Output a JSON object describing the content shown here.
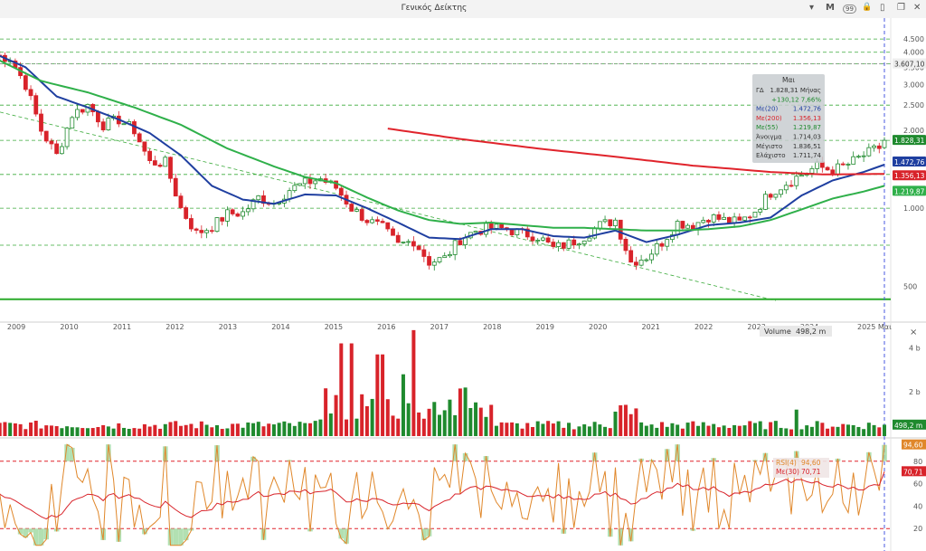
{
  "window": {
    "title": "Γενικός Δείκτης",
    "controls": {
      "dropdown": "▾",
      "period": "M",
      "badge": "99",
      "lock": "🔒",
      "split": "▯",
      "restore": "❐",
      "close": "✕"
    }
  },
  "colors": {
    "up": "#1f8a2e",
    "down": "#d8232a",
    "ma20": "#1f3fa0",
    "ma55": "#2fb04a",
    "ma200": "#e0242c",
    "rsi": "#e0872a",
    "rsiAvg": "#d8232a"
  },
  "chart_data": {
    "type": "candlestick",
    "interval": "monthly",
    "price_axis": {
      "scale": "log",
      "ticks": [
        "4.500",
        "4.000",
        "3.500",
        "3.000",
        "2.500",
        "2.000",
        "1.500",
        "1.000",
        "500"
      ]
    },
    "x_ticks": [
      "2009",
      "2010",
      "2011",
      "2012",
      "2013",
      "2014",
      "2015",
      "2016",
      "2017",
      "2018",
      "2019",
      "2020",
      "2021",
      "2022",
      "2023",
      "2024",
      "2025"
    ],
    "current_period_label": "Μαι",
    "last_label": "2025 Μαι",
    "horizontal_levels": [
      {
        "label": "3.607,10"
      },
      {
        "label": "1.828,31"
      }
    ],
    "infobox": {
      "header": "Μαι",
      "rows": [
        {
          "k": "ΓΔ",
          "v": "1.828,31 Μήνας",
          "color": "#333"
        },
        {
          "k": "",
          "v": "+130,12 7,66%",
          "color": "#1f8a2e"
        },
        {
          "k": "Με(20)",
          "v": "1.472,76",
          "color": "#1f3fa0"
        },
        {
          "k": "Με(200)",
          "v": "1.356,13",
          "color": "#d8232a"
        },
        {
          "k": "Με(55)",
          "v": "1.219,87",
          "color": "#1f8a2e"
        },
        {
          "k": "Άνοιγμα",
          "v": "1.714,03",
          "color": "#333"
        },
        {
          "k": "Μέγιστο",
          "v": "1.836,51",
          "color": "#333"
        },
        {
          "k": "Ελάχιστο",
          "v": "1.711,74",
          "color": "#333"
        }
      ]
    },
    "price_labels": [
      {
        "text": "1.828,31",
        "color": "#1f8a2e",
        "value": 1828.31
      },
      {
        "text": "1.472,76",
        "color": "#1f3fa0",
        "value": 1472.76
      },
      {
        "text": "1.356,13",
        "color": "#d8232a",
        "value": 1356.13
      },
      {
        "text": "1.219,87",
        "color": "#2fb04a",
        "value": 1219.87
      }
    ],
    "price_anchors": [
      [
        0,
        3900
      ],
      [
        3,
        3800
      ],
      [
        6,
        3000
      ],
      [
        9,
        2000
      ],
      [
        12,
        1600
      ],
      [
        15,
        2300
      ],
      [
        18,
        2500
      ],
      [
        21,
        2100
      ],
      [
        24,
        2200
      ],
      [
        27,
        2000
      ],
      [
        30,
        1500
      ],
      [
        33,
        1500
      ],
      [
        36,
        1000
      ],
      [
        39,
        800
      ],
      [
        42,
        850
      ],
      [
        45,
        950
      ],
      [
        48,
        960
      ],
      [
        51,
        1100
      ],
      [
        54,
        1050
      ],
      [
        57,
        1180
      ],
      [
        60,
        1250
      ],
      [
        63,
        1300
      ],
      [
        66,
        1200
      ],
      [
        69,
        1000
      ],
      [
        72,
        900
      ],
      [
        75,
        840
      ],
      [
        78,
        720
      ],
      [
        81,
        750
      ],
      [
        84,
        620
      ],
      [
        87,
        640
      ],
      [
        90,
        760
      ],
      [
        93,
        820
      ],
      [
        96,
        840
      ],
      [
        99,
        830
      ],
      [
        102,
        800
      ],
      [
        105,
        780
      ],
      [
        108,
        700
      ],
      [
        111,
        730
      ],
      [
        114,
        780
      ],
      [
        117,
        860
      ],
      [
        120,
        900
      ],
      [
        123,
        620
      ],
      [
        126,
        650
      ],
      [
        129,
        740
      ],
      [
        132,
        880
      ],
      [
        135,
        860
      ],
      [
        138,
        930
      ],
      [
        141,
        900
      ],
      [
        144,
        880
      ],
      [
        147,
        980
      ],
      [
        150,
        1150
      ],
      [
        153,
        1250
      ],
      [
        156,
        1350
      ],
      [
        159,
        1450
      ],
      [
        162,
        1400
      ],
      [
        165,
        1480
      ],
      [
        168,
        1600
      ],
      [
        171,
        1714
      ],
      [
        172,
        1828.31
      ]
    ],
    "ma_lines": [
      {
        "name": "Με(20)",
        "points": [
          [
            0,
            3950
          ],
          [
            6,
            3500
          ],
          [
            12,
            2700
          ],
          [
            18,
            2450
          ],
          [
            24,
            2200
          ],
          [
            30,
            1950
          ],
          [
            36,
            1600
          ],
          [
            42,
            1220
          ],
          [
            48,
            1080
          ],
          [
            54,
            1040
          ],
          [
            60,
            1130
          ],
          [
            66,
            1120
          ],
          [
            72,
            1000
          ],
          [
            78,
            880
          ],
          [
            84,
            770
          ],
          [
            90,
            760
          ],
          [
            96,
            830
          ],
          [
            102,
            830
          ],
          [
            108,
            780
          ],
          [
            114,
            770
          ],
          [
            120,
            820
          ],
          [
            126,
            740
          ],
          [
            132,
            790
          ],
          [
            138,
            860
          ],
          [
            144,
            880
          ],
          [
            150,
            920
          ],
          [
            156,
            1120
          ],
          [
            162,
            1280
          ],
          [
            168,
            1380
          ],
          [
            172,
            1472.76
          ]
        ]
      },
      {
        "name": "Με(55)",
        "points": [
          [
            0,
            3800
          ],
          [
            9,
            3100
          ],
          [
            18,
            2800
          ],
          [
            27,
            2450
          ],
          [
            36,
            2100
          ],
          [
            45,
            1700
          ],
          [
            54,
            1450
          ],
          [
            60,
            1320
          ],
          [
            66,
            1250
          ],
          [
            72,
            1100
          ],
          [
            78,
            980
          ],
          [
            84,
            900
          ],
          [
            90,
            870
          ],
          [
            96,
            880
          ],
          [
            102,
            860
          ],
          [
            108,
            840
          ],
          [
            114,
            840
          ],
          [
            120,
            830
          ],
          [
            126,
            820
          ],
          [
            132,
            820
          ],
          [
            138,
            830
          ],
          [
            144,
            850
          ],
          [
            150,
            900
          ],
          [
            156,
            990
          ],
          [
            162,
            1090
          ],
          [
            168,
            1160
          ],
          [
            172,
            1219.87
          ]
        ]
      },
      {
        "name": "Με(200)",
        "points": [
          [
            76,
            2030
          ],
          [
            90,
            1850
          ],
          [
            105,
            1700
          ],
          [
            120,
            1580
          ],
          [
            135,
            1460
          ],
          [
            150,
            1380
          ],
          [
            160,
            1350
          ],
          [
            172,
            1356.13
          ]
        ]
      }
    ],
    "volume": {
      "label": "Volume",
      "value_text": "498,2 m",
      "axis_ticks": [
        "4 b",
        "2 b"
      ],
      "axis_label_current": "498,2 m"
    },
    "rsi": {
      "label": "RSI(4)",
      "value_text": "94,60",
      "avg_label": "Με(30)",
      "avg_value_text": "70,71",
      "levels": [
        80,
        20
      ],
      "axis_ticks": [
        "80",
        "60",
        "40",
        "20"
      ],
      "current_labels": [
        {
          "text": "94,60",
          "value": 94.6
        },
        {
          "text": "70,71",
          "value": 70.71
        }
      ]
    }
  }
}
